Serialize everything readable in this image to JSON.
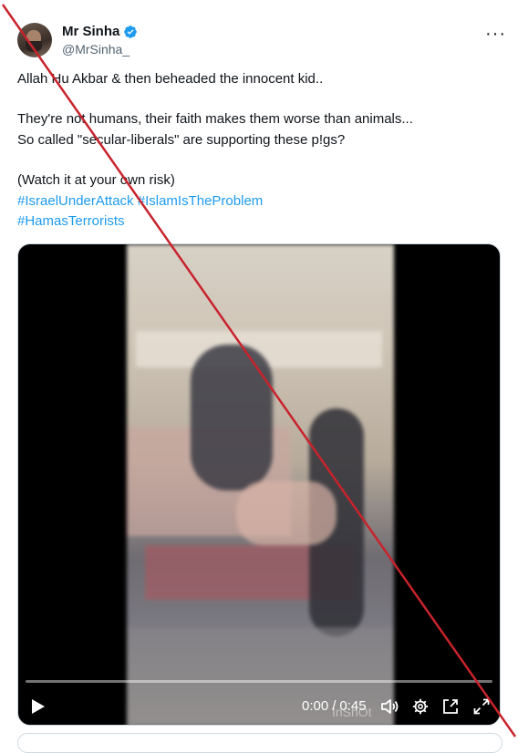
{
  "author": {
    "display_name": "Mr Sinha",
    "handle": "@MrSinha_",
    "verified": true,
    "verified_color": "#1d9bf0"
  },
  "more_label": "···",
  "tweet": {
    "line1": "Allah Hu Akbar & then beheaded the innocent kid..",
    "line2": "They're not humans, their faith makes them worse than animals...",
    "line3": "So called \"secular-liberals\" are supporting these p!gs?",
    "line4": "(Watch it at your own risk)",
    "hashtags": [
      "#IsraelUnderAttack",
      "#IslamIsTheProblem",
      "#HamasTerrorists"
    ]
  },
  "video": {
    "watermark": "InShOt",
    "progress": 0,
    "current_time": "0:00",
    "separator": "/",
    "duration": "0:45",
    "icons": [
      "play-icon",
      "volume-icon",
      "settings-icon",
      "pop-out-icon",
      "fullscreen-icon"
    ]
  },
  "overlay": {
    "cross_color": "#c8232c"
  },
  "colors": {
    "link": "#1d9bf0",
    "text": "#0f1419",
    "muted": "#536471"
  }
}
